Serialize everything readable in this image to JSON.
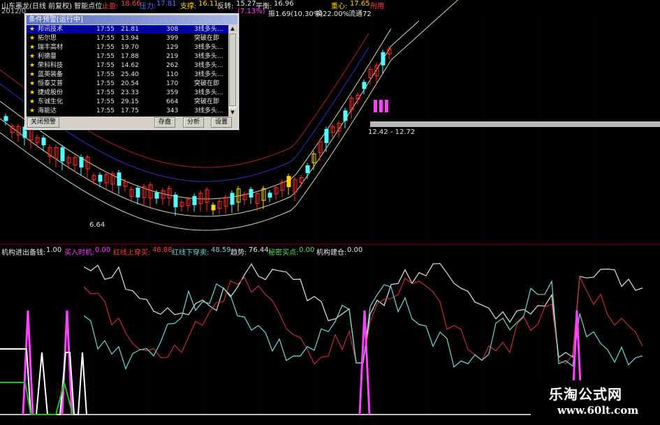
{
  "topbar": {
    "title": "山东墨龙(日线 前复权) 智能点位",
    "zhiying_label": "止盈:",
    "zhiying_value": "18.66",
    "yali_label": "压力:",
    "yali_value": "17.81",
    "zhicheng_label": "支撑:",
    "zhicheng_value": "16.11",
    "fanzhuan_label": "反转:",
    "fanzhuan_value": "15.27",
    "pingheng_label": "平衡:",
    "pingheng_value": "16.96",
    "zhongxin_label": "重心:",
    "zhongxin_value": "17.65",
    "tail_red": "刑用",
    "row2_date": "2012/0",
    "row2_pct": "(7.13%)",
    "row2_zhen": "振1.69(10.30%)",
    "row2_huan": "换22.00%",
    "row2_liutong": "流通72"
  },
  "alert_window": {
    "title": "条件预警[运行中]",
    "rows": [
      {
        "name": "邦讯技术",
        "time": "17:55",
        "price": "21.81",
        "vol": "308",
        "signal": "3线多头..."
      },
      {
        "name": "拓尔思",
        "time": "17:55",
        "price": "13.94",
        "vol": "399",
        "signal": "突破在即"
      },
      {
        "name": "瑞丰高材",
        "time": "17:55",
        "price": "19.70",
        "vol": "129",
        "signal": "3线多头..."
      },
      {
        "name": "利德曼",
        "time": "17:55",
        "price": "17.88",
        "vol": "219",
        "signal": "3线多头..."
      },
      {
        "name": "荣科科技",
        "time": "17:55",
        "price": "14.62",
        "vol": "262",
        "signal": "3线多头..."
      },
      {
        "name": "蓝英装备",
        "time": "17:55",
        "price": "25.40",
        "vol": "110",
        "signal": "3线多头..."
      },
      {
        "name": "恒泰艾普",
        "time": "17:55",
        "price": "20.54",
        "vol": "170",
        "signal": "突破在即"
      },
      {
        "name": "捷成股份",
        "time": "17:55",
        "price": "23.33",
        "vol": "359",
        "signal": "3线多头..."
      },
      {
        "name": "东诚生化",
        "time": "17:55",
        "price": "29.15",
        "vol": "664",
        "signal": "突破在即"
      },
      {
        "name": "海能达",
        "time": "17:55",
        "price": "17.75",
        "vol": "343",
        "signal": "3线多头..."
      }
    ],
    "btn_close": "关闭预警",
    "btn_save": "存盘",
    "btn_analyze": "分析",
    "btn_settings": "设置"
  },
  "price_labels": {
    "low": "6.64",
    "range": "12.42 - 12.72"
  },
  "indicator": {
    "name": "机构进出",
    "beiqian_label": "备钱:",
    "beiqian_value": "1.00",
    "mairu_label": "买入时机:",
    "mairu_value": "0.00",
    "hongxian_shang_label": "红线上穿买:",
    "hongxian_shang_value": "48.88",
    "hongxian_xia_label": "红线下穿卖:",
    "hongxian_xia_value": "48.59",
    "qushi_label": "趋势:",
    "qushi_value": "76.44",
    "mimi_label": "秘密买点:",
    "mimi_value": "0.00",
    "jigou_label": "机构建仓:",
    "jigou_value": "0.00"
  },
  "watermark": {
    "line1": "乐淘公式网",
    "line2": "www.60lt.com"
  },
  "colors": {
    "up_candle": "#ff3030",
    "down_candle": "#54ffff",
    "yellow_candle": "#ffd800",
    "magenta": "#ff40ff",
    "band_red": "#b02020",
    "band_blue": "#3030c0",
    "band_light": "#d8d8b0",
    "ind_white": "#e0e0e0",
    "ind_red": "#c03030",
    "ind_cyan": "#70d8d8"
  }
}
